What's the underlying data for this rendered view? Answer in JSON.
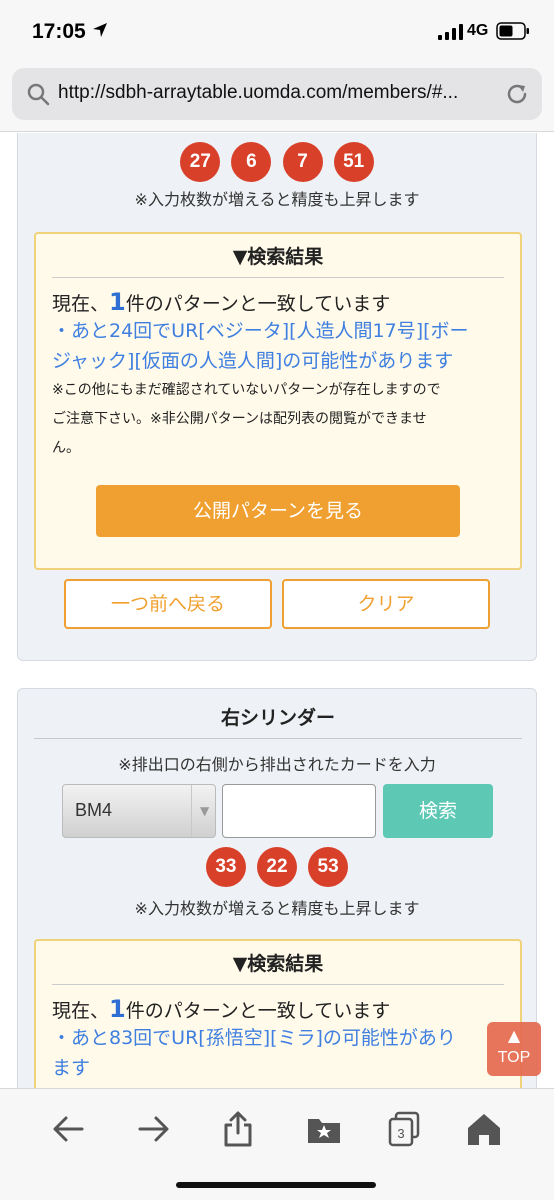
{
  "status_bar": {
    "time": "17:05",
    "network": "4G"
  },
  "browser": {
    "url": "http://sdbh-arraytable.uomda.com/members/#..."
  },
  "panel1": {
    "balls": [
      "27",
      "6",
      "7",
      "51"
    ],
    "note": "※入力枚数が増えると精度も上昇します",
    "result": {
      "title": "▼検索結果",
      "match_prefix": "現在、",
      "match_count": "1",
      "match_suffix": "件のパターンと一致しています",
      "prediction_line1": "・あと24回でUR[ベジータ][人造人間17号][ボー",
      "prediction_line2": "ジャック][仮面の人造人間]の可能性があります",
      "caution_line1": "※この他にもまだ確認されていないパターンが存在しますので",
      "caution_line2": "ご注意下さい。※非公開パターンは配列表の閲覧ができませ",
      "caution_line3": "ん。",
      "view_button": "公開パターンを見る"
    },
    "back_button": "一つ前へ戻る",
    "clear_button": "クリア"
  },
  "panel2": {
    "title": "右シリンダー",
    "instruction": "※排出口の右側から排出されたカードを入力",
    "select_value": "BM4",
    "input_value": "",
    "search_button": "検索",
    "balls": [
      "33",
      "22",
      "53"
    ],
    "note": "※入力枚数が増えると精度も上昇します",
    "result": {
      "title": "▼検索結果",
      "match_prefix": "現在、",
      "match_count": "1",
      "match_suffix": "件のパターンと一致しています",
      "prediction_line1": "・あと83回でUR[孫悟空][ミラ]の可能性があり",
      "prediction_line2": "ます"
    }
  },
  "top_button": {
    "arrow": "▲",
    "label": "TOP"
  },
  "toolbar": {
    "tabs_count": "3"
  }
}
